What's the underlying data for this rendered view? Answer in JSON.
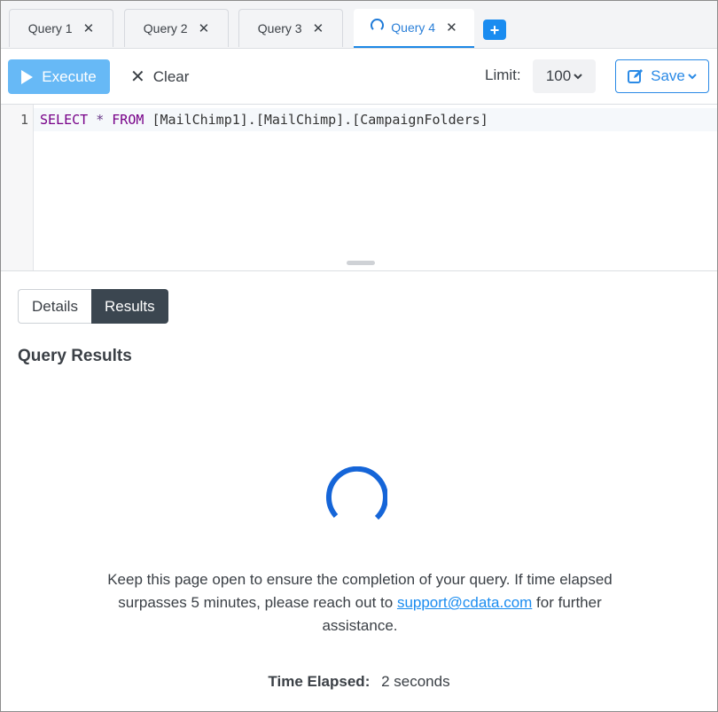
{
  "tabs": [
    {
      "label": "Query 1",
      "active": false,
      "loading": false
    },
    {
      "label": "Query 2",
      "active": false,
      "loading": false
    },
    {
      "label": "Query 3",
      "active": false,
      "loading": false
    },
    {
      "label": "Query 4",
      "active": true,
      "loading": true
    }
  ],
  "add_tab_label": "+",
  "close_glyph": "✕",
  "toolbar": {
    "execute_label": "Execute",
    "clear_label": "Clear",
    "limit_label": "Limit:",
    "limit_value": "100",
    "save_label": "Save"
  },
  "editor": {
    "line_number": "1",
    "query_keyword_select": "SELECT",
    "query_star": "*",
    "query_keyword_from": "FROM",
    "query_table": "[MailChimp1].[MailChimp].[CampaignFolders]"
  },
  "results": {
    "details_tab": "Details",
    "results_tab": "Results",
    "title": "Query Results",
    "message_before": "Keep this page open to ensure the completion of your query. If time elapsed surpasses 5 minutes, please reach out to ",
    "support_email": "support@cdata.com",
    "message_after": " for further assistance.",
    "elapsed_label": "Time Elapsed:",
    "elapsed_value": "2 seconds"
  },
  "colors": {
    "accent": "#1a8cf0",
    "execute_bg": "#67b9f6",
    "results_tab_bg": "#3b4650"
  }
}
